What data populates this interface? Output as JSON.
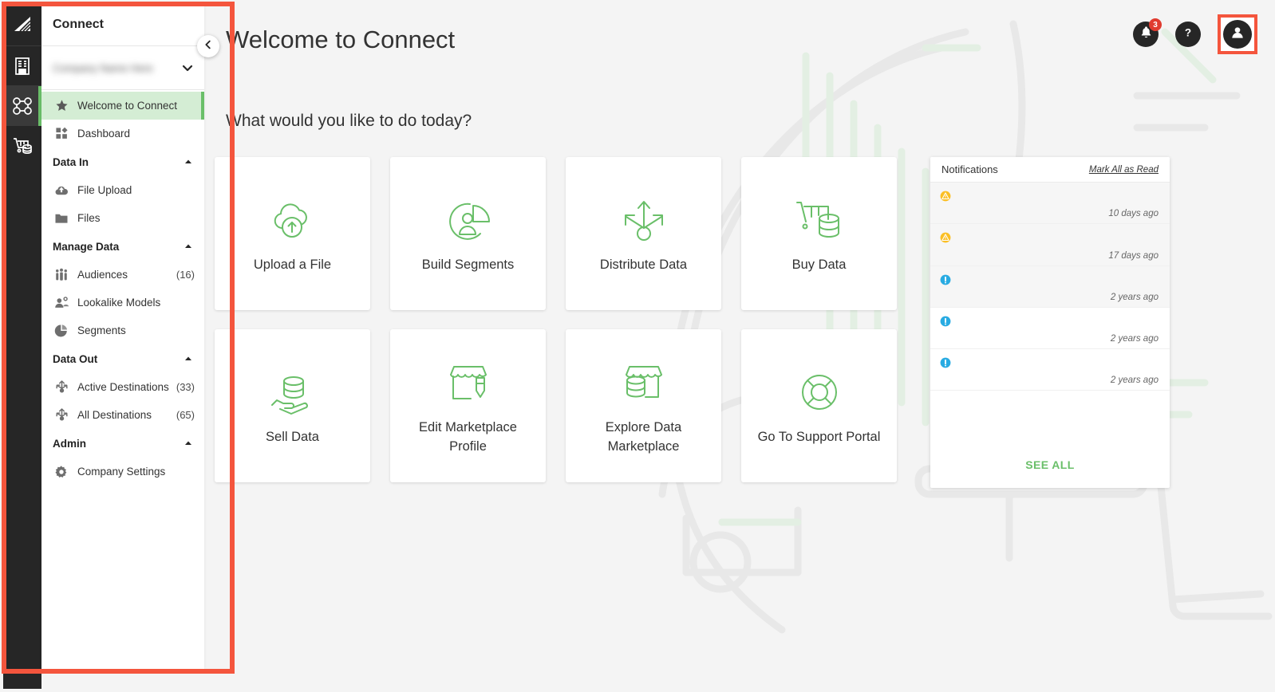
{
  "app": {
    "title": "Connect"
  },
  "rail": {
    "items": [
      {
        "name": "logo",
        "icon": "brand-logo-icon",
        "active": false
      },
      {
        "name": "company",
        "icon": "building-icon",
        "active": false
      },
      {
        "name": "connect",
        "icon": "nodes-icon",
        "active": true
      },
      {
        "name": "marketplace",
        "icon": "cart-database-icon",
        "active": false
      }
    ]
  },
  "sidebar": {
    "title": "Connect",
    "company_selector": {
      "name": "",
      "redacted": true,
      "icon": "chevron-down-icon"
    },
    "collapse_icon": "chevron-left-icon",
    "nav": [
      {
        "type": "item",
        "label": "Welcome to Connect",
        "icon": "star-icon",
        "count": "",
        "selected": true
      },
      {
        "type": "item",
        "label": "Dashboard",
        "icon": "dashboard-icon",
        "count": "",
        "selected": false
      },
      {
        "type": "group",
        "label": "Data In",
        "icon": "caret-up-icon"
      },
      {
        "type": "item",
        "label": "File Upload",
        "icon": "cloud-upload-icon",
        "count": "",
        "selected": false
      },
      {
        "type": "item",
        "label": "Files",
        "icon": "folder-icon",
        "count": "",
        "selected": false
      },
      {
        "type": "group",
        "label": "Manage Data",
        "icon": "caret-up-icon"
      },
      {
        "type": "item",
        "label": "Audiences",
        "icon": "people-icon",
        "count": "(16)",
        "selected": false
      },
      {
        "type": "item",
        "label": "Lookalike Models",
        "icon": "lookalike-icon",
        "count": "",
        "selected": false
      },
      {
        "type": "item",
        "label": "Segments",
        "icon": "pie-chart-icon",
        "count": "",
        "selected": false
      },
      {
        "type": "group",
        "label": "Data Out",
        "icon": "caret-up-icon"
      },
      {
        "type": "item",
        "label": "Active Destinations",
        "icon": "distribute-icon",
        "count": "(33)",
        "selected": false
      },
      {
        "type": "item",
        "label": "All Destinations",
        "icon": "distribute-icon",
        "count": "(65)",
        "selected": false
      },
      {
        "type": "group",
        "label": "Admin",
        "icon": "caret-up-icon"
      },
      {
        "type": "item",
        "label": "Company Settings",
        "icon": "gear-icon",
        "count": "",
        "selected": false
      }
    ]
  },
  "main": {
    "page_title": "Welcome to Connect",
    "subtitle": "What would you like to do today?",
    "cards": [
      {
        "label": "Upload a File",
        "icon": "cloud-upload-outline-icon"
      },
      {
        "label": "Build Segments",
        "icon": "segment-pie-person-icon"
      },
      {
        "label": "Distribute Data",
        "icon": "distribute-arrows-icon"
      },
      {
        "label": "Buy Data",
        "icon": "cart-database-outline-icon"
      },
      {
        "label": "Sell Data",
        "icon": "hand-database-icon"
      },
      {
        "label": "Edit Marketplace Profile",
        "icon": "storefront-pencil-icon"
      },
      {
        "label": "Explore Data Marketplace",
        "icon": "storefront-database-icon"
      },
      {
        "label": "Go To Support Portal",
        "icon": "life-ring-icon"
      }
    ]
  },
  "notifications": {
    "title": "Notifications",
    "mark_all_label": "Mark All as Read",
    "see_all_label": "SEE ALL",
    "items": [
      {
        "severity": "warning",
        "icon": "warning-icon",
        "text": "                                          ",
        "time": "10 days ago",
        "unread": true
      },
      {
        "severity": "warning",
        "icon": "warning-icon",
        "text": "                                          ",
        "time": "17 days ago",
        "unread": true
      },
      {
        "severity": "info",
        "icon": "info-icon",
        "text": "                               ",
        "time": "2 years ago",
        "unread": true
      },
      {
        "severity": "info",
        "icon": "info-icon",
        "text": "                              ",
        "time": "2 years ago",
        "unread": false
      },
      {
        "severity": "info",
        "icon": "info-icon",
        "text": "                              ",
        "time": "2 years ago",
        "unread": false
      }
    ]
  },
  "header": {
    "notifications_icon": "bell-icon",
    "notifications_badge": "3",
    "help_icon": "question-mark-icon",
    "profile_icon": "user-avatar-icon"
  },
  "colors": {
    "accent_green": "#6ABF69",
    "highlight_green": "#d4edd4",
    "dark": "#262626",
    "annotation_red": "#F4553D",
    "badge_red": "#E03B2F",
    "warning_yellow": "#FBBF24",
    "info_blue": "#29ABE2"
  }
}
